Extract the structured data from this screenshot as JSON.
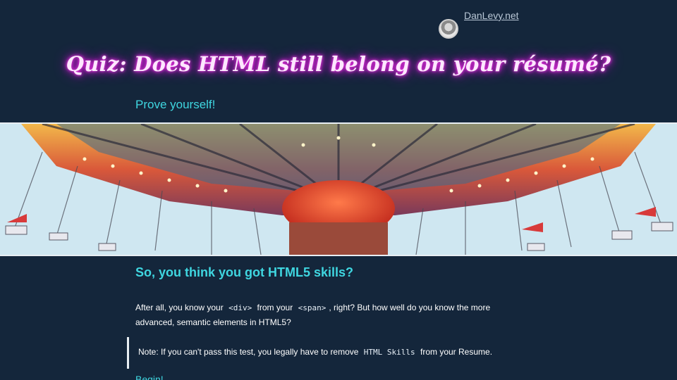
{
  "header": {
    "site_link": "DanLevy.net"
  },
  "quiz": {
    "title": "Quiz: Does HTML still belong on your résumé?",
    "subtitle": "Prove yourself!"
  },
  "intro": {
    "heading": "So, you think you got HTML5 skills?",
    "text_1": "After all, you know your",
    "code_1": "<div>",
    "text_2": "from your",
    "code_2": "<span>",
    "text_3": ", right? But how well do you know the more advanced, semantic elements in HTML5?"
  },
  "note": {
    "text_1": "Note: If you can't pass this test, you legally have to remove",
    "code": "HTML Skills",
    "text_2": "from your Resume."
  },
  "begin_label": "Begin!",
  "colors": {
    "background": "#14263b",
    "accent": "#3fd6e0",
    "neon_glow": "#e020e0"
  }
}
